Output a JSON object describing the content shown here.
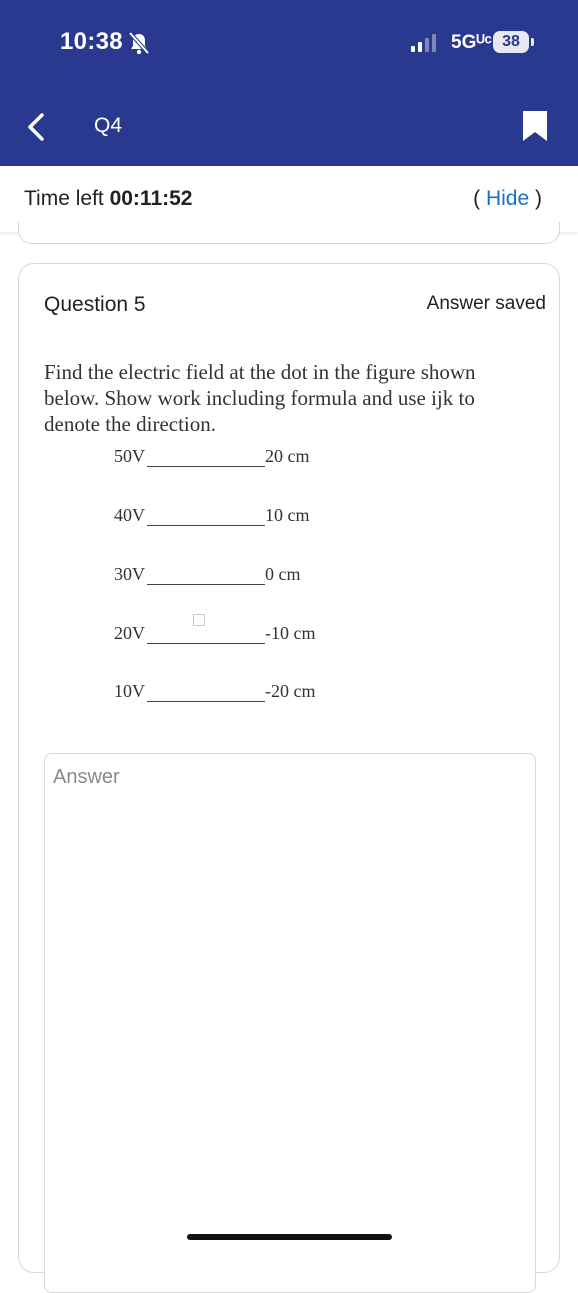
{
  "status_bar": {
    "time": "10:38",
    "network": "5Gᵁᶜ",
    "battery": "38"
  },
  "nav": {
    "title": "Q4"
  },
  "timer": {
    "label": "Time left",
    "value": "00:11:52",
    "open_paren": "( ",
    "hide_label": "Hide",
    "close_paren": " )"
  },
  "question": {
    "title": "Question 5",
    "status": "Answer saved",
    "prompt": "Find the electric field at the dot in the figure shown below. Show work including formula and use ijk to denote the direction.",
    "figure": [
      {
        "voltage": "50V",
        "position": "20 cm"
      },
      {
        "voltage": "40V",
        "position": "10 cm"
      },
      {
        "voltage": "30V",
        "position": "0 cm"
      },
      {
        "voltage": "20V",
        "position": "-10 cm"
      },
      {
        "voltage": "10V",
        "position": "-20 cm"
      }
    ],
    "answer_placeholder": "Answer"
  },
  "colors": {
    "header_bg": "#2a3990",
    "link": "#1a6fc4"
  },
  "icons": [
    "bell-muted-icon",
    "signal-icon",
    "back-chevron-icon",
    "bookmark-icon"
  ]
}
